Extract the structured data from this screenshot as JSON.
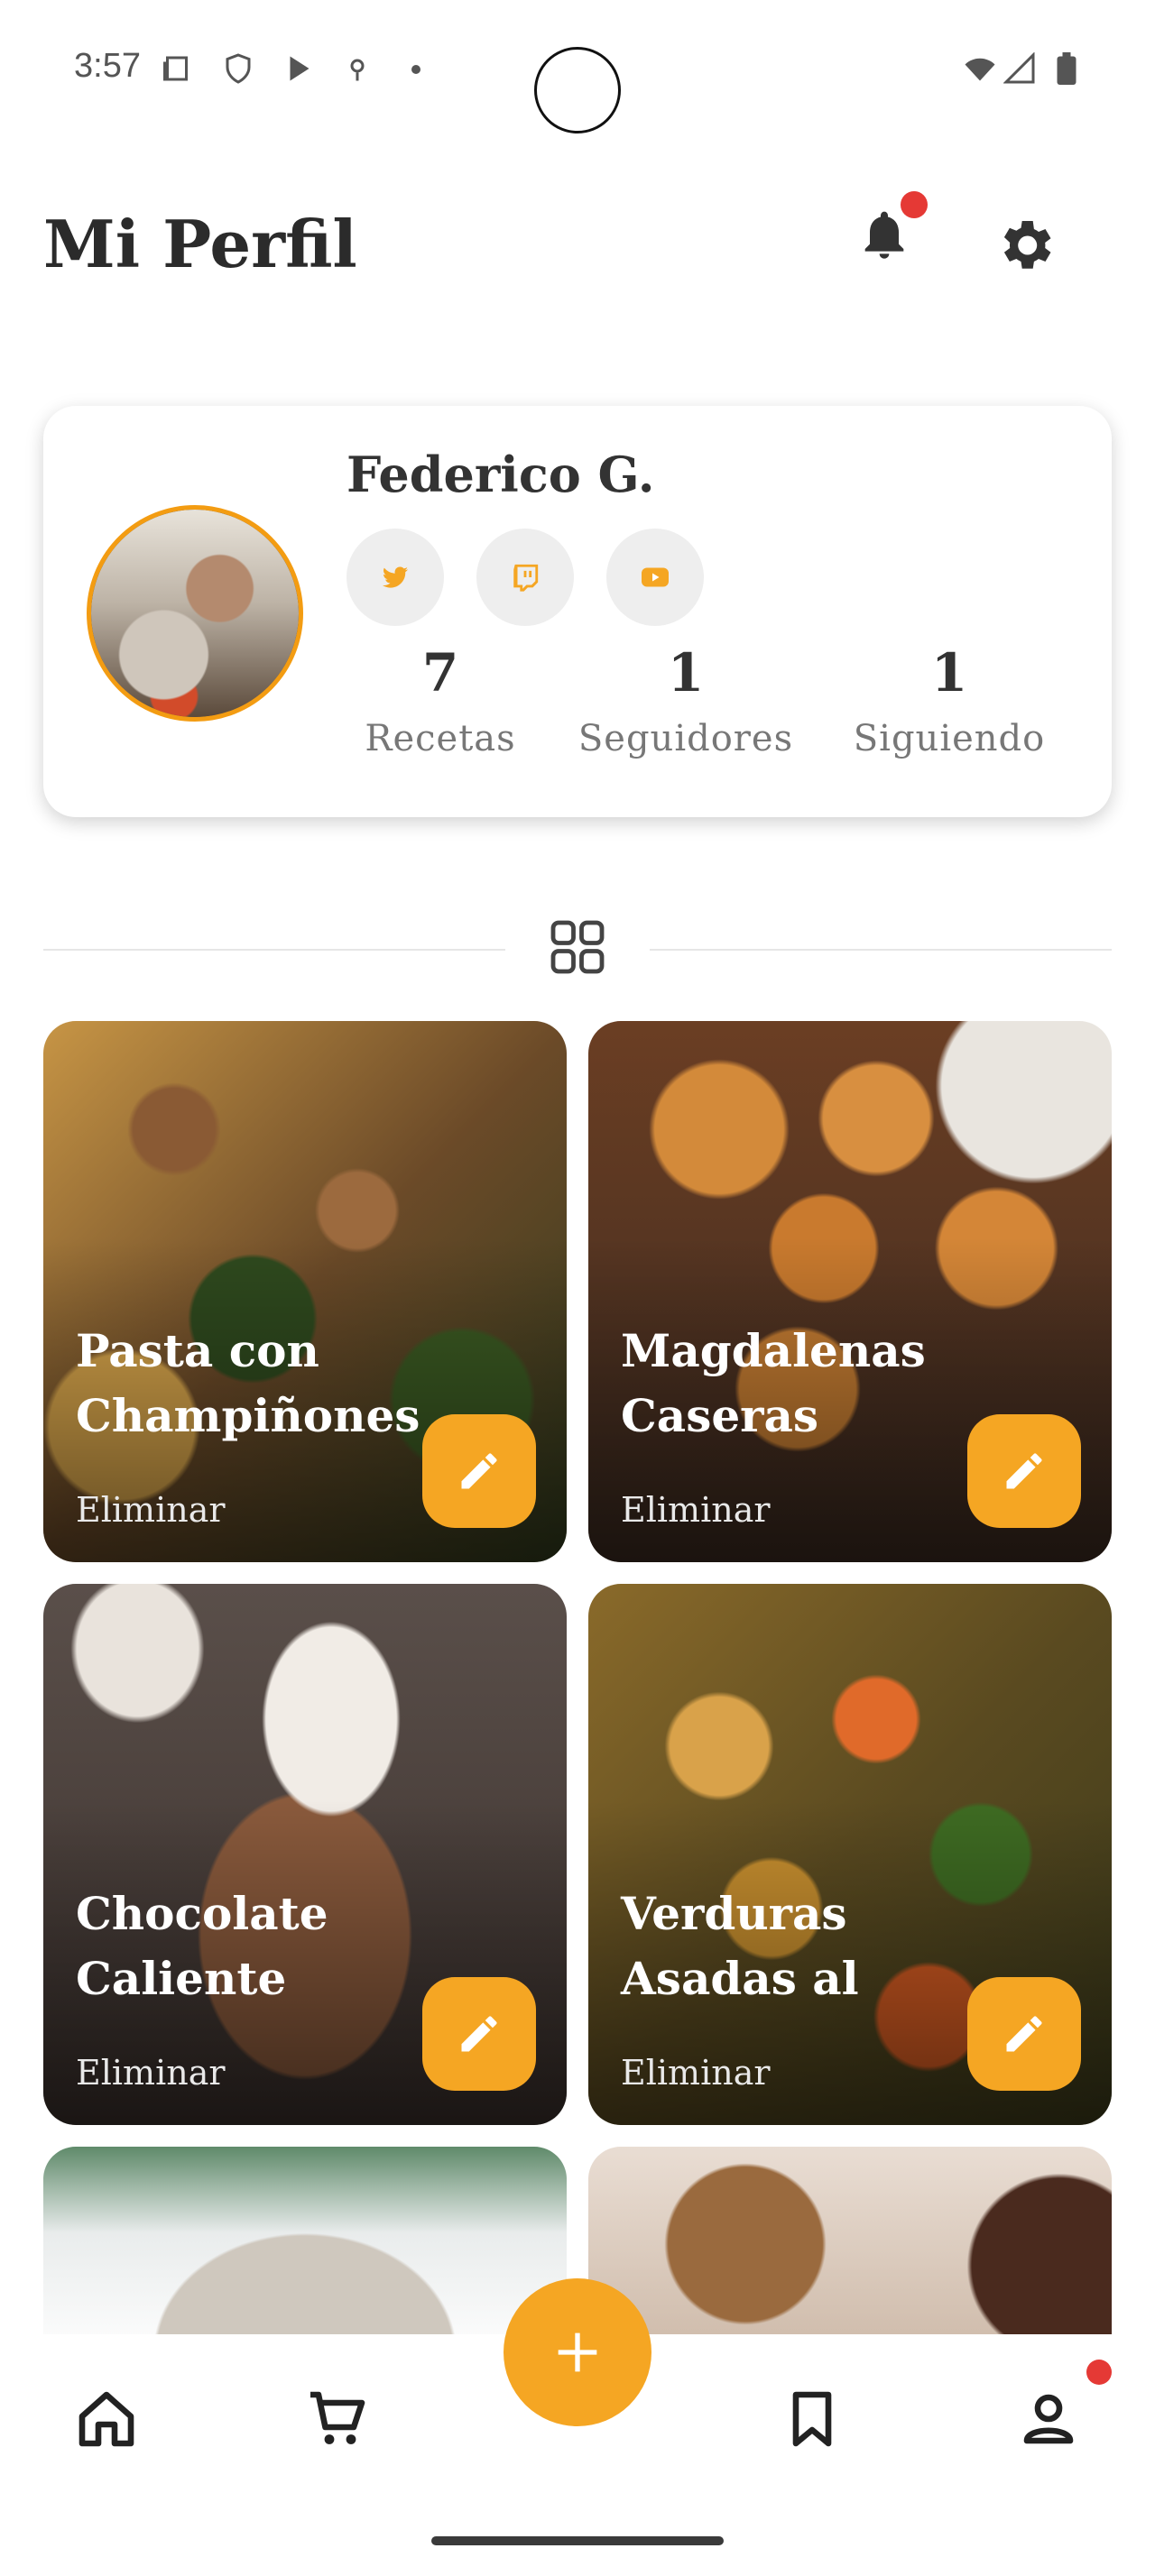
{
  "status_bar": {
    "time": "3:57"
  },
  "header": {
    "title": "Mi Perfil"
  },
  "profile": {
    "name": "Federico G.",
    "social": [
      "twitter-icon",
      "twitch-icon",
      "youtube-icon"
    ],
    "stats": [
      {
        "value": "7",
        "label": "Recetas"
      },
      {
        "value": "1",
        "label": "Seguidores"
      },
      {
        "value": "1",
        "label": "Siguiendo"
      }
    ]
  },
  "recipes": [
    {
      "title": "Pasta con Champiñones",
      "delete_label": "Eliminar"
    },
    {
      "title": "Magdalenas Caseras",
      "delete_label": "Eliminar"
    },
    {
      "title": "Chocolate Caliente",
      "delete_label": "Eliminar"
    },
    {
      "title": "Verduras Asadas al",
      "delete_label": "Eliminar"
    }
  ],
  "colors": {
    "accent": "#f5a623",
    "avatar_ring": "#f39c12",
    "notification": "#e53935"
  }
}
